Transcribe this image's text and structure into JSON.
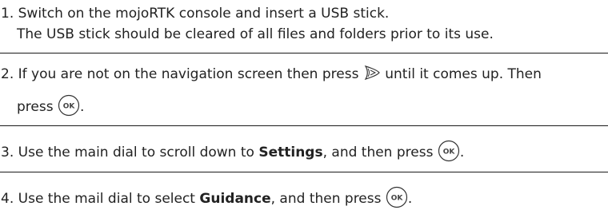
{
  "steps": [
    {
      "number": "1.",
      "line1": "Switch on the mojoRTK console and insert a USB stick.",
      "line2": "The USB stick should be cleared of all files and folders prior to its use."
    },
    {
      "number": "2.",
      "part1": "If you are not on the navigation screen then press",
      "part2": "until it comes up. Then",
      "part3": "press",
      "part4": "."
    },
    {
      "number": "3.",
      "part1": "Use the main dial to scroll down to",
      "bold": "Settings",
      "part2": ", and then press",
      "part3": "."
    },
    {
      "number": "4.",
      "part1": "Use the mail dial to select",
      "bold": "Guidance",
      "part2": ", and then press",
      "part3": "."
    }
  ],
  "ok_button_label": "OK",
  "icons": {
    "ok": "ok-button-icon",
    "nav": "navigation-key-icon"
  }
}
